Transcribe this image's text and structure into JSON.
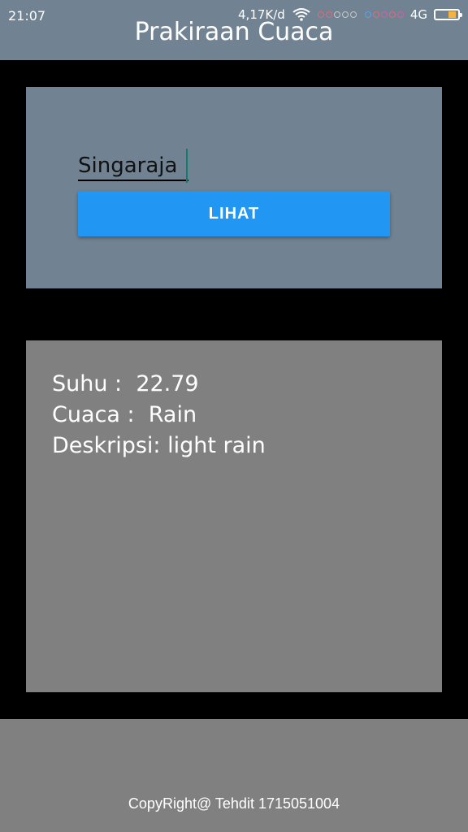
{
  "status_bar": {
    "time": "21:07",
    "speed": "4,17K/d",
    "network": "4G",
    "icons": [
      "wifi-icon",
      "signal-dots-icon",
      "battery-icon"
    ]
  },
  "app": {
    "title": "Prakiraan Cuaca"
  },
  "search": {
    "value": "Singaraja",
    "button_label": "LIHAT"
  },
  "weather": {
    "temp_line": "Suhu :  22.79",
    "condition_line": "Cuaca :  Rain",
    "description_line": "Deskripsi: light rain"
  },
  "footer": {
    "copyright": "CopyRight@ Tehdit 1715051004"
  },
  "colors": {
    "header": "#718393",
    "button": "#2196f3",
    "result_panel": "#808080",
    "background": "#000000"
  }
}
